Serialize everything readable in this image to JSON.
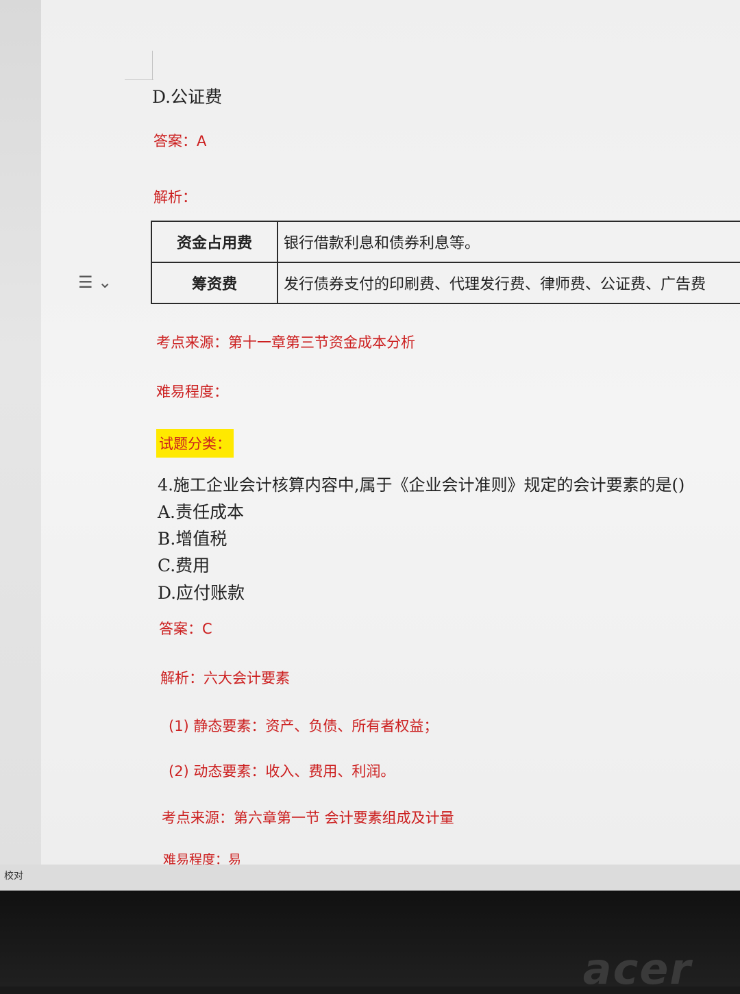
{
  "question3": {
    "option_d": "D.公证费",
    "answer": "答案：A",
    "analysis_label": "解析：",
    "table": [
      {
        "key": "资金占用费",
        "value": "银行借款利息和债券利息等。"
      },
      {
        "key": "筹资费",
        "value": "发行债券支付的印刷费、代理发行费、律师费、公证费、广告费"
      }
    ],
    "source": "考点来源：第十一章第三节资金成本分析",
    "difficulty": "难易程度：",
    "category": "试题分类："
  },
  "question4": {
    "stem": "4.施工企业会计核算内容中,属于《企业会计准则》规定的会计要素的是()",
    "options": [
      "A.责任成本",
      "B.增值税",
      "C.费用",
      "D.应付账款"
    ],
    "answer": "答案：C",
    "analysis": "解析：六大会计要素",
    "point1": "(1) 静态要素：资产、负债、所有者权益；",
    "point2": "(2) 动态要素：收入、费用、利润。",
    "source": "考点来源：第六章第一节 会计要素组成及计量",
    "difficulty": "难易程度：易"
  },
  "sidebar": {
    "icon": "list-icon"
  },
  "status_bar": {
    "label": "校对"
  },
  "monitor": {
    "brand": "acer"
  },
  "colors": {
    "answer_red": "#cc1f1f",
    "highlight": "#ffe900",
    "body_text": "#222222"
  }
}
